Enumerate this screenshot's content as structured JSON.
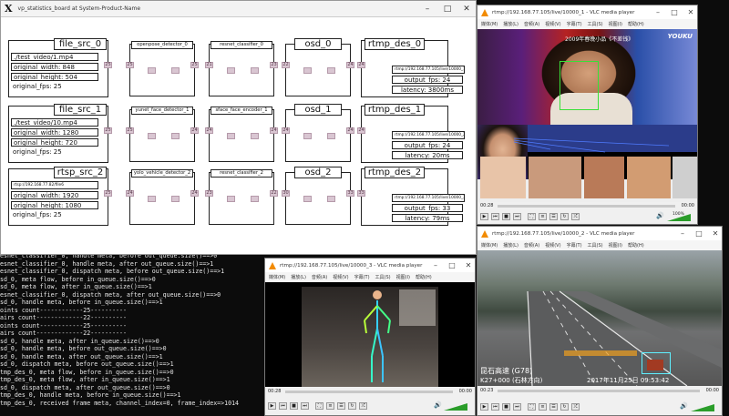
{
  "board": {
    "title": "vp_statistics_board at System-Product-Name",
    "rows": [
      {
        "src": {
          "title": "file_src_0",
          "fields": [
            "./test_video/1.mp4",
            "original_width: 848",
            "original_height: 504",
            "original_fps: 25"
          ],
          "port_in": "",
          "port_out": "25"
        },
        "detector": {
          "title": "openpose_detector_0",
          "port_in": "25",
          "port_out": "25"
        },
        "classifier": {
          "title": "resnet_classifier_0",
          "port_in": "21",
          "port_out": "23"
        },
        "osd": {
          "title": "osd_0",
          "port_in": "22",
          "port_out": "24"
        },
        "des": {
          "title": "rtmp_des_0",
          "fields": [
            "rtmp://192.168.77.105/live/10000_1",
            "output_fps: 24",
            "latency: 3800ms"
          ],
          "port_in": "24"
        }
      },
      {
        "src": {
          "title": "file_src_1",
          "fields": [
            "./test_video/10.mp4",
            "original_width: 1280",
            "original_height: 720",
            "original_fps: 25"
          ],
          "port_in": "",
          "port_out": "25"
        },
        "detector": {
          "title": "yunet_face_detector_1",
          "port_in": "25",
          "port_out": "24"
        },
        "classifier": {
          "title": "sface_face_encoder_1",
          "port_in": "24",
          "port_out": "24"
        },
        "osd": {
          "title": "osd_1",
          "port_in": "24",
          "port_out": "24"
        },
        "des": {
          "title": "rtmp_des_1",
          "fields": [
            "rtmp://192.168.77.105/live/10000_2",
            "output_fps: 24",
            "latency: 20ms"
          ],
          "port_in": "24"
        }
      },
      {
        "src": {
          "title": "rtsp_src_2",
          "fields": [
            "rtsp://192.168.77.82/file6",
            "original_width: 1920",
            "original_height: 1080",
            "original_fps: 25"
          ],
          "port_in": "",
          "port_out": "25"
        },
        "detector": {
          "title": "yolo_vehicle_detector_2",
          "port_in": "24",
          "port_out": "24"
        },
        "classifier": {
          "title": "resnet_classifier_2",
          "port_in": "23",
          "port_out": "22"
        },
        "osd": {
          "title": "osd_2",
          "port_in": "30",
          "port_out": "33"
        },
        "des": {
          "title": "rtmp_des_2",
          "fields": [
            "rtmp://192.168.77.105/live/10000_3",
            "output_fps: 33",
            "latency: 79ms"
          ],
          "port_in": "33"
        }
      }
    ]
  },
  "terminal": {
    "lines": [
      "esnet_classifier_0, handle meta, before out_queue.size()==>0",
      "esnet_classifier_0, handle meta, after out_queue.size()==>1",
      "esnet_classifier_0, dispatch meta, before out_queue.size()==>1",
      "sd_0, meta flow, before in_queue.size()==>0",
      "sd_0, meta flow, after in_queue.size()==>1",
      "esnet_classifier_0, dispatch meta, after out_queue.size()==>0",
      "sd_0, handle meta, before in_queue.size()==>1",
      "oints count------------25----------",
      "airs count-------------22----------",
      "oints count------------25----------",
      "airs count-------------22----------",
      "sd_0, handle meta, after in_queue.size()==>0",
      "sd_0, handle meta, before out_queue.size()==>0",
      "sd_0, handle meta, after out_queue.size()==>1",
      "sd_0, dispatch meta, before out_queue.size()==>1",
      "tmp_des_0, meta flow, before in_queue.size()==>0",
      "tmp_des_0, meta flow, after in_queue.size()==>1",
      "sd_0, dispatch meta, after out_queue.size()==>0",
      "tmp_des_0, handle meta, before in_queue.size()==>1",
      "tmp_des_0, received frame meta, channel_index=0, frame_index=>1014"
    ]
  },
  "vlc_menu": [
    "媒体(M)",
    "播放(L)",
    "音频(A)",
    "视频(V)",
    "字幕(T)",
    "工具(S)",
    "视图(I)",
    "帮助(H)"
  ],
  "vlc_top": {
    "title": "rtmp://192.168.77.105/live/10000_1 - VLC media player",
    "time_left": "00:28",
    "time_right": "00:00",
    "overlay_title": "2009年春晚小品《不差钱》",
    "watermark": "YOUKU",
    "volume": "100%",
    "progress": 0.0
  },
  "vlc_bottom": {
    "title": "rtmp://192.168.77.105/live/10000_3 - VLC media player",
    "time_left": "00:28",
    "time_right": "00:00",
    "volume": "",
    "progress": 0.0
  },
  "vlc_right": {
    "title": "rtmp://192.168.77.105/live/10000_2 - VLC media player",
    "time_left": "00:23",
    "time_right": "00:00",
    "caption_line1": "昆石高速 (G78)",
    "caption_line2": "K27+000 (石林方向)",
    "timestamp": "2017年11月25日 09:53:42",
    "volume": "",
    "progress": 0.0
  },
  "icons": [
    "vlc-cone-icon",
    "play-icon",
    "stop-icon",
    "prev-icon",
    "next-icon",
    "fullscreen-icon",
    "playlist-icon",
    "loop-icon",
    "shuffle-icon",
    "volume-icon",
    "minimize-icon",
    "maximize-icon",
    "close-icon"
  ],
  "colors": {
    "port": "#d9c6d2",
    "vlc_progress": "#1e78d0",
    "volume": "#2a9d2a",
    "face_box": "#38e038",
    "vehicle_box": "#5ff0ff"
  }
}
